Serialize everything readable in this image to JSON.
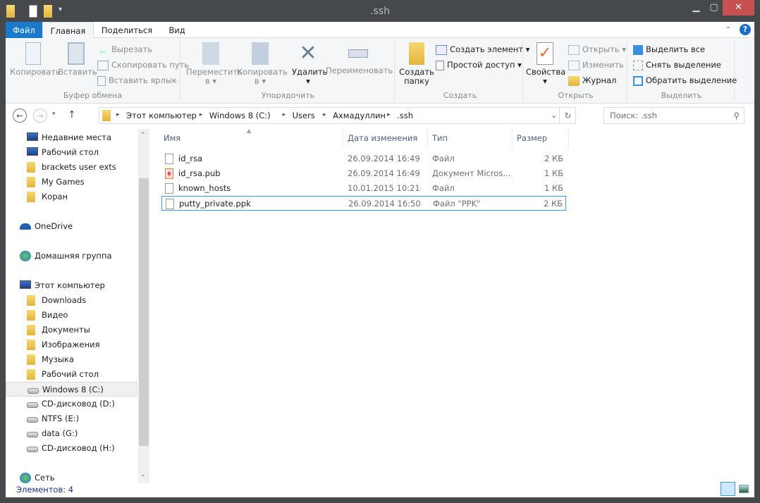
{
  "window": {
    "title": ".ssh"
  },
  "tabs": [
    {
      "label": "Файл"
    },
    {
      "label": "Главная"
    },
    {
      "label": "Поделиться"
    },
    {
      "label": "Вид"
    }
  ],
  "ribbon": {
    "clipboard": {
      "label": "Буфер обмена",
      "copy": "Копировать",
      "paste": "Вставить",
      "cut": "Вырезать",
      "copy_path": "Скопировать путь",
      "paste_shortcut": "Вставить ярлык"
    },
    "organize": {
      "label": "Упорядочить",
      "move_to": "Переместить",
      "move_to_2": "в",
      "copy_to": "Копировать",
      "copy_to_2": "в",
      "delete": "Удалить",
      "rename": "Переименовать"
    },
    "create": {
      "label": "Создать",
      "new_folder": "Создать",
      "new_folder_2": "папку",
      "new_item": "Создать элемент",
      "easy_access": "Простой доступ"
    },
    "open": {
      "label": "Открыть",
      "properties": "Свойства",
      "open": "Открыть",
      "edit": "Изменить",
      "history": "Журнал"
    },
    "select": {
      "label": "Выделить",
      "select_all": "Выделить все",
      "select_none": "Снять выделение",
      "invert": "Обратить выделение"
    }
  },
  "address": {
    "crumbs": [
      "Этот компьютер",
      "Windows 8 (C:)",
      "Users",
      "Ахмадуллин",
      ".ssh"
    ]
  },
  "search": {
    "placeholder": "Поиск: .ssh"
  },
  "nav": {
    "groups": [
      {
        "items": [
          {
            "label": "Недавние места",
            "icon": "recent-places",
            "indent": 1
          },
          {
            "label": "Рабочий стол",
            "icon": "desktop",
            "indent": 1
          },
          {
            "label": "brackets user exts",
            "icon": "folder",
            "indent": 1
          },
          {
            "label": "My Games",
            "icon": "folder",
            "indent": 1
          },
          {
            "label": "Коран",
            "icon": "folder",
            "indent": 1
          }
        ]
      },
      {
        "items": [
          {
            "label": "OneDrive",
            "icon": "onedrive",
            "indent": 0
          }
        ]
      },
      {
        "items": [
          {
            "label": "Домашняя группа",
            "icon": "homegroup",
            "indent": 0
          }
        ]
      },
      {
        "items": [
          {
            "label": "Этот компьютер",
            "icon": "computer",
            "indent": 0
          },
          {
            "label": "Downloads",
            "icon": "folder",
            "indent": 1
          },
          {
            "label": "Видео",
            "icon": "folder",
            "indent": 1
          },
          {
            "label": "Документы",
            "icon": "folder",
            "indent": 1
          },
          {
            "label": "Изображения",
            "icon": "folder",
            "indent": 1
          },
          {
            "label": "Музыка",
            "icon": "folder",
            "indent": 1
          },
          {
            "label": "Рабочий стол",
            "icon": "folder",
            "indent": 1
          },
          {
            "label": "Windows 8 (C:)",
            "icon": "drive",
            "indent": 1,
            "selected": true
          },
          {
            "label": "CD-дисковод (D:)",
            "icon": "cd-drive",
            "indent": 1
          },
          {
            "label": "NTFS (E:)",
            "icon": "drive",
            "indent": 1
          },
          {
            "label": "data (G:)",
            "icon": "drive",
            "indent": 1
          },
          {
            "label": "CD-дисковод (H:)",
            "icon": "cd-drive",
            "indent": 1
          }
        ]
      },
      {
        "items": [
          {
            "label": "Сеть",
            "icon": "network",
            "indent": 0
          }
        ]
      }
    ]
  },
  "columns": {
    "name": "Имя",
    "date": "Дата изменения",
    "type": "Тип",
    "size": "Размер"
  },
  "files": [
    {
      "name": "id_rsa",
      "date": "26.09.2014 16:49",
      "type": "Файл",
      "size": "2 КБ",
      "icon": "file"
    },
    {
      "name": "id_rsa.pub",
      "date": "26.09.2014 16:49",
      "type": "Документ Micros...",
      "size": "1 КБ",
      "icon": "publisher-doc"
    },
    {
      "name": "known_hosts",
      "date": "10.01.2015 10:21",
      "type": "Файл",
      "size": "1 КБ",
      "icon": "file"
    },
    {
      "name": "putty_private.ppk",
      "date": "26.09.2014 16:50",
      "type": "Файл \"PPK\"",
      "size": "2 КБ",
      "icon": "file",
      "selected": true
    }
  ],
  "status": {
    "items": "Элементов: 4"
  },
  "colors": {
    "accent": "#1979ca",
    "close": "#c75050",
    "selection_border": "#3399ff",
    "frame": "#45494c"
  }
}
